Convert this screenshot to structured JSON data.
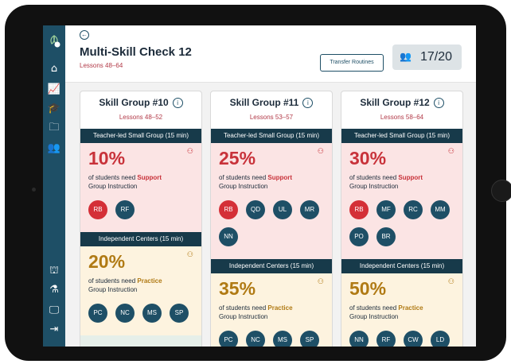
{
  "header": {
    "title": "Multi-Skill Check 12",
    "subtitle": "Lessons 48–64",
    "transfer_label": "Transfer Routines",
    "count": "17/20"
  },
  "sidebar": {
    "top_icons": [
      "logo-icon",
      "home-icon",
      "chart-icon",
      "graduation-cap-icon",
      "folder-icon",
      "users-icon"
    ],
    "bottom_icons": [
      "library-icon",
      "flask-icon",
      "presentation-icon",
      "logout-icon"
    ]
  },
  "groups": [
    {
      "title": "Skill Group #10",
      "lessons": "Lessons 48–52",
      "teacher_band": "Teacher-led Small Group (15 min)",
      "support_pct": "10%",
      "support_prefix": "of students need",
      "support_kw": "Support",
      "support_suffix": "Group Instruction",
      "support_students": [
        "RB",
        "RF"
      ],
      "centers_band": "Independent Centers (15 min)",
      "practice_pct": "20%",
      "practice_prefix": "of students need",
      "practice_kw": "Practice",
      "practice_suffix": "Group Instruction",
      "practice_students": [
        "PC",
        "NC",
        "MS",
        "SP"
      ]
    },
    {
      "title": "Skill Group #11",
      "lessons": "Lessons 53–57",
      "teacher_band": "Teacher-led Small Group (15 min)",
      "support_pct": "25%",
      "support_prefix": "of students need",
      "support_kw": "Support",
      "support_suffix": "Group Instruction",
      "support_students": [
        "RB",
        "QD",
        "UL",
        "MR",
        "NN"
      ],
      "centers_band": "Independent Centers (15 min)",
      "practice_pct": "35%",
      "practice_prefix": "of students need",
      "practice_kw": "Practice",
      "practice_suffix": "Group Instruction",
      "practice_students": [
        "PC",
        "NC",
        "MS",
        "SP"
      ]
    },
    {
      "title": "Skill Group #12",
      "lessons": "Lessons 58–64",
      "teacher_band": "Teacher-led Small Group (15 min)",
      "support_pct": "30%",
      "support_prefix": "of students need",
      "support_kw": "Support",
      "support_suffix": "Group Instruction",
      "support_students": [
        "RB",
        "MF",
        "RC",
        "MM",
        "PO",
        "BR"
      ],
      "centers_band": "Independent Centers (15 min)",
      "practice_pct": "50%",
      "practice_prefix": "of students need",
      "practice_kw": "Practice",
      "practice_suffix": "Group Instruction",
      "practice_students": [
        "NN",
        "RF",
        "CW",
        "LD"
      ]
    }
  ],
  "colors": {
    "sidebar": "#1e4f66",
    "band": "#173a4a",
    "support": "#c8323a",
    "practice": "#b07a14"
  }
}
